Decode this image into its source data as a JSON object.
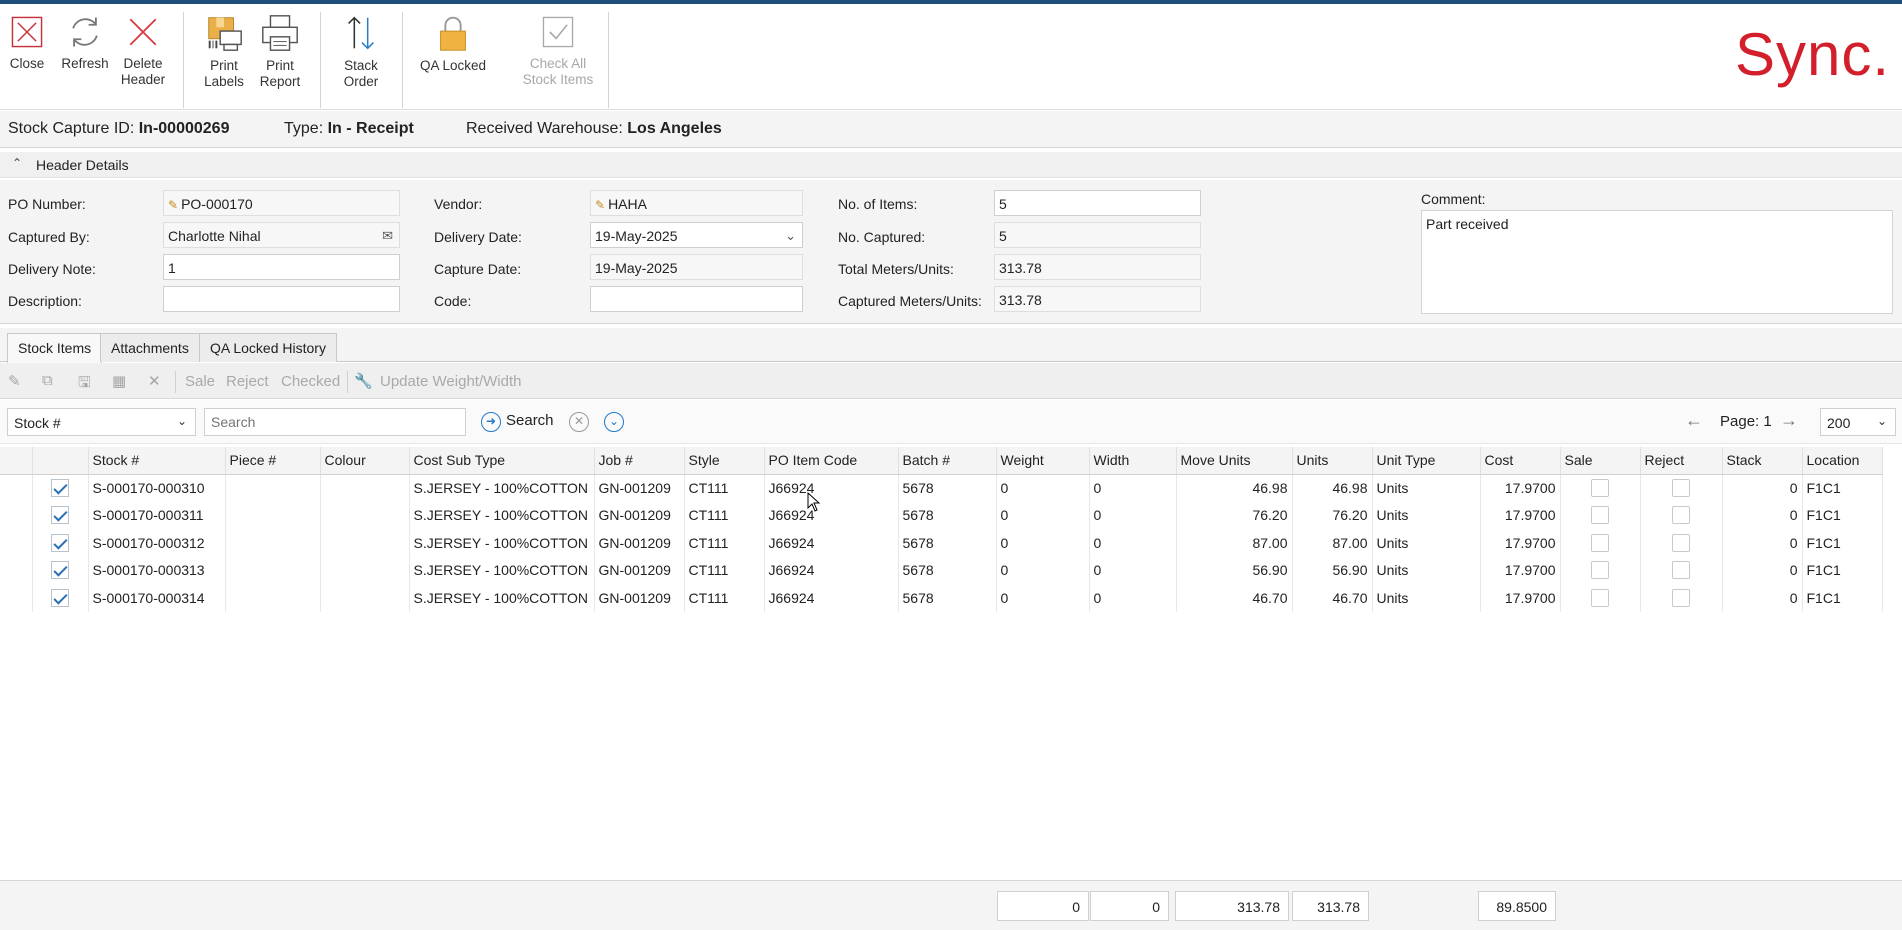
{
  "ribbon": {
    "buttons": [
      {
        "label": "Close",
        "icon": "close-icon"
      },
      {
        "label": "Refresh",
        "icon": "refresh-icon"
      },
      {
        "label": "Delete Header",
        "icon": "delete-icon"
      },
      {
        "label": "Print Labels",
        "icon": "print-labels-icon"
      },
      {
        "label": "Print Report",
        "icon": "printer-icon"
      },
      {
        "label": "Stack Order",
        "icon": "sort-arrows-icon"
      },
      {
        "label": "QA Locked",
        "icon": "padlock-icon"
      },
      {
        "label": "Check All Stock Items",
        "icon": "checkbox-icon"
      }
    ],
    "brand": "Sync.",
    "brand_color": "#d21f2b"
  },
  "idbar": {
    "id_label": "Stock Capture ID:",
    "id_value": "In-00000269",
    "type_label": "Type:",
    "type_value": "In - Receipt",
    "warehouse_label": "Received Warehouse:",
    "warehouse_value": "Los Angeles"
  },
  "header": {
    "section_title": "Header Details",
    "po_number_label": "PO Number:",
    "po_number": "PO-000170",
    "captured_by_label": "Captured By:",
    "captured_by": "Charlotte Nihal",
    "delivery_note_label": "Delivery Note:",
    "delivery_note": "1",
    "description_label": "Description:",
    "description": "",
    "vendor_label": "Vendor:",
    "vendor": "HAHA",
    "delivery_date_label": "Delivery Date:",
    "delivery_date": "19-May-2025",
    "capture_date_label": "Capture Date:",
    "capture_date": "19-May-2025",
    "code_label": "Code:",
    "code": "",
    "items_label": "No. of Items:",
    "items": "5",
    "captured_label": "No. Captured:",
    "captured": "5",
    "total_label": "Total Meters/Units:",
    "total": "313.78",
    "captured_units_label": "Captured Meters/Units:",
    "captured_units": "313.78",
    "comment_label": "Comment:",
    "comment": "Part received"
  },
  "tabs": [
    "Stock Items",
    "Attachments",
    "QA Locked History"
  ],
  "toolbar": {
    "sale": "Sale",
    "reject": "Reject",
    "checked": "Checked",
    "update": "Update Weight/Width"
  },
  "search": {
    "field": "Stock #",
    "placeholder": "Search",
    "button": "Search",
    "page": "Page: 1",
    "page_size": "200"
  },
  "grid": {
    "columns": [
      "Stock #",
      "Piece #",
      "Colour",
      "Cost Sub Type",
      "Job #",
      "Style",
      "PO Item Code",
      "Batch #",
      "Weight",
      "Width",
      "Move Units",
      "Units",
      "Unit Type",
      "Cost",
      "Sale",
      "Reject",
      "Stack",
      "Location"
    ],
    "rows": [
      {
        "stock": "S-000170-000310",
        "piece": "",
        "colour": "",
        "cost_sub_type": "S.JERSEY - 100%COTTON",
        "job": "GN-001209",
        "style": "CT111",
        "po_item": "J66924",
        "batch": "5678",
        "weight": "0",
        "width": "0",
        "move_units": "46.98",
        "units": "46.98",
        "unit_type": "Units",
        "cost": "17.9700",
        "stack": "0",
        "location": "F1C1"
      },
      {
        "stock": "S-000170-000311",
        "piece": "",
        "colour": "",
        "cost_sub_type": "S.JERSEY - 100%COTTON",
        "job": "GN-001209",
        "style": "CT111",
        "po_item": "J66924",
        "batch": "5678",
        "weight": "0",
        "width": "0",
        "move_units": "76.20",
        "units": "76.20",
        "unit_type": "Units",
        "cost": "17.9700",
        "stack": "0",
        "location": "F1C1"
      },
      {
        "stock": "S-000170-000312",
        "piece": "",
        "colour": "",
        "cost_sub_type": "S.JERSEY - 100%COTTON",
        "job": "GN-001209",
        "style": "CT111",
        "po_item": "J66924",
        "batch": "5678",
        "weight": "0",
        "width": "0",
        "move_units": "87.00",
        "units": "87.00",
        "unit_type": "Units",
        "cost": "17.9700",
        "stack": "0",
        "location": "F1C1"
      },
      {
        "stock": "S-000170-000313",
        "piece": "",
        "colour": "",
        "cost_sub_type": "S.JERSEY - 100%COTTON",
        "job": "GN-001209",
        "style": "CT111",
        "po_item": "J66924",
        "batch": "5678",
        "weight": "0",
        "width": "0",
        "move_units": "56.90",
        "units": "56.90",
        "unit_type": "Units",
        "cost": "17.9700",
        "stack": "0",
        "location": "F1C1"
      },
      {
        "stock": "S-000170-000314",
        "piece": "",
        "colour": "",
        "cost_sub_type": "S.JERSEY - 100%COTTON",
        "job": "GN-001209",
        "style": "CT111",
        "po_item": "J66924",
        "batch": "5678",
        "weight": "0",
        "width": "0",
        "move_units": "46.70",
        "units": "46.70",
        "unit_type": "Units",
        "cost": "17.9700",
        "stack": "0",
        "location": "F1C1"
      }
    ]
  },
  "totals": {
    "weight": "0",
    "width": "0",
    "move_units": "313.78",
    "units": "313.78",
    "cost": "89.8500"
  }
}
